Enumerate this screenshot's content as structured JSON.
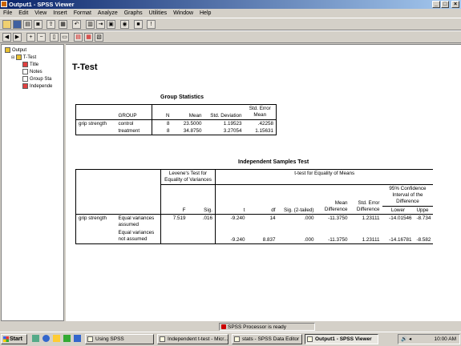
{
  "window": {
    "title": "Output1 - SPSS Viewer"
  },
  "menu": [
    "File",
    "Edit",
    "View",
    "Insert",
    "Format",
    "Analyze",
    "Graphs",
    "Utilities",
    "Window",
    "Help"
  ],
  "outline": {
    "root": "Output",
    "group": "T-Test",
    "items": [
      "Title",
      "Notes",
      "Group Sta",
      "Independe"
    ]
  },
  "page": {
    "title": "T-Test",
    "group_stats": {
      "caption": "Group Statistics",
      "headers": [
        "GROUP",
        "N",
        "Mean",
        "Std. Deviation",
        "Std. Error Mean"
      ],
      "variable": "grip strength",
      "rows": [
        {
          "group": "control",
          "n": "8",
          "mean": "23.5000",
          "sd": "1.19523",
          "se": ".42258"
        },
        {
          "group": "treatment",
          "n": "8",
          "mean": "34.8750",
          "sd": "3.27054",
          "se": "1.15631"
        }
      ]
    },
    "ind_test": {
      "caption": "Independent Samples Test",
      "levene_header": "Levene's Test for Equality of Variances",
      "ttest_header": "t-test for Equality of Means",
      "ci_header": "95% Confidence Interval of the Difference",
      "cols": [
        "F",
        "Sig.",
        "t",
        "df",
        "Sig. (2-tailed)",
        "Mean Difference",
        "Std. Error Difference",
        "Lower",
        "Uppe"
      ],
      "variable": "grip strength",
      "rows": [
        {
          "label": "Equal variances assumed",
          "F": "7.519",
          "sig": ".016",
          "t": "-9.240",
          "df": "14",
          "sig2": ".000",
          "md": "-11.3750",
          "sed": "1.23111",
          "lower": "-14.01546",
          "upper": "-8.734"
        },
        {
          "label": "Equal variances not assumed",
          "F": "",
          "sig": "",
          "t": "-9.240",
          "df": "8.837",
          "sig2": ".000",
          "md": "-11.3750",
          "sed": "1.23111",
          "lower": "-14.16781",
          "upper": "-8.582"
        }
      ]
    }
  },
  "status": {
    "message": "SPSS Processor  is ready"
  },
  "taskbar": {
    "start": "Start",
    "tasks": [
      "Using SPSS",
      "Independent t-test - Micr...",
      "stats - SPSS Data Editor",
      "Output1 - SPSS Viewer"
    ],
    "clock": "10:00 AM"
  }
}
